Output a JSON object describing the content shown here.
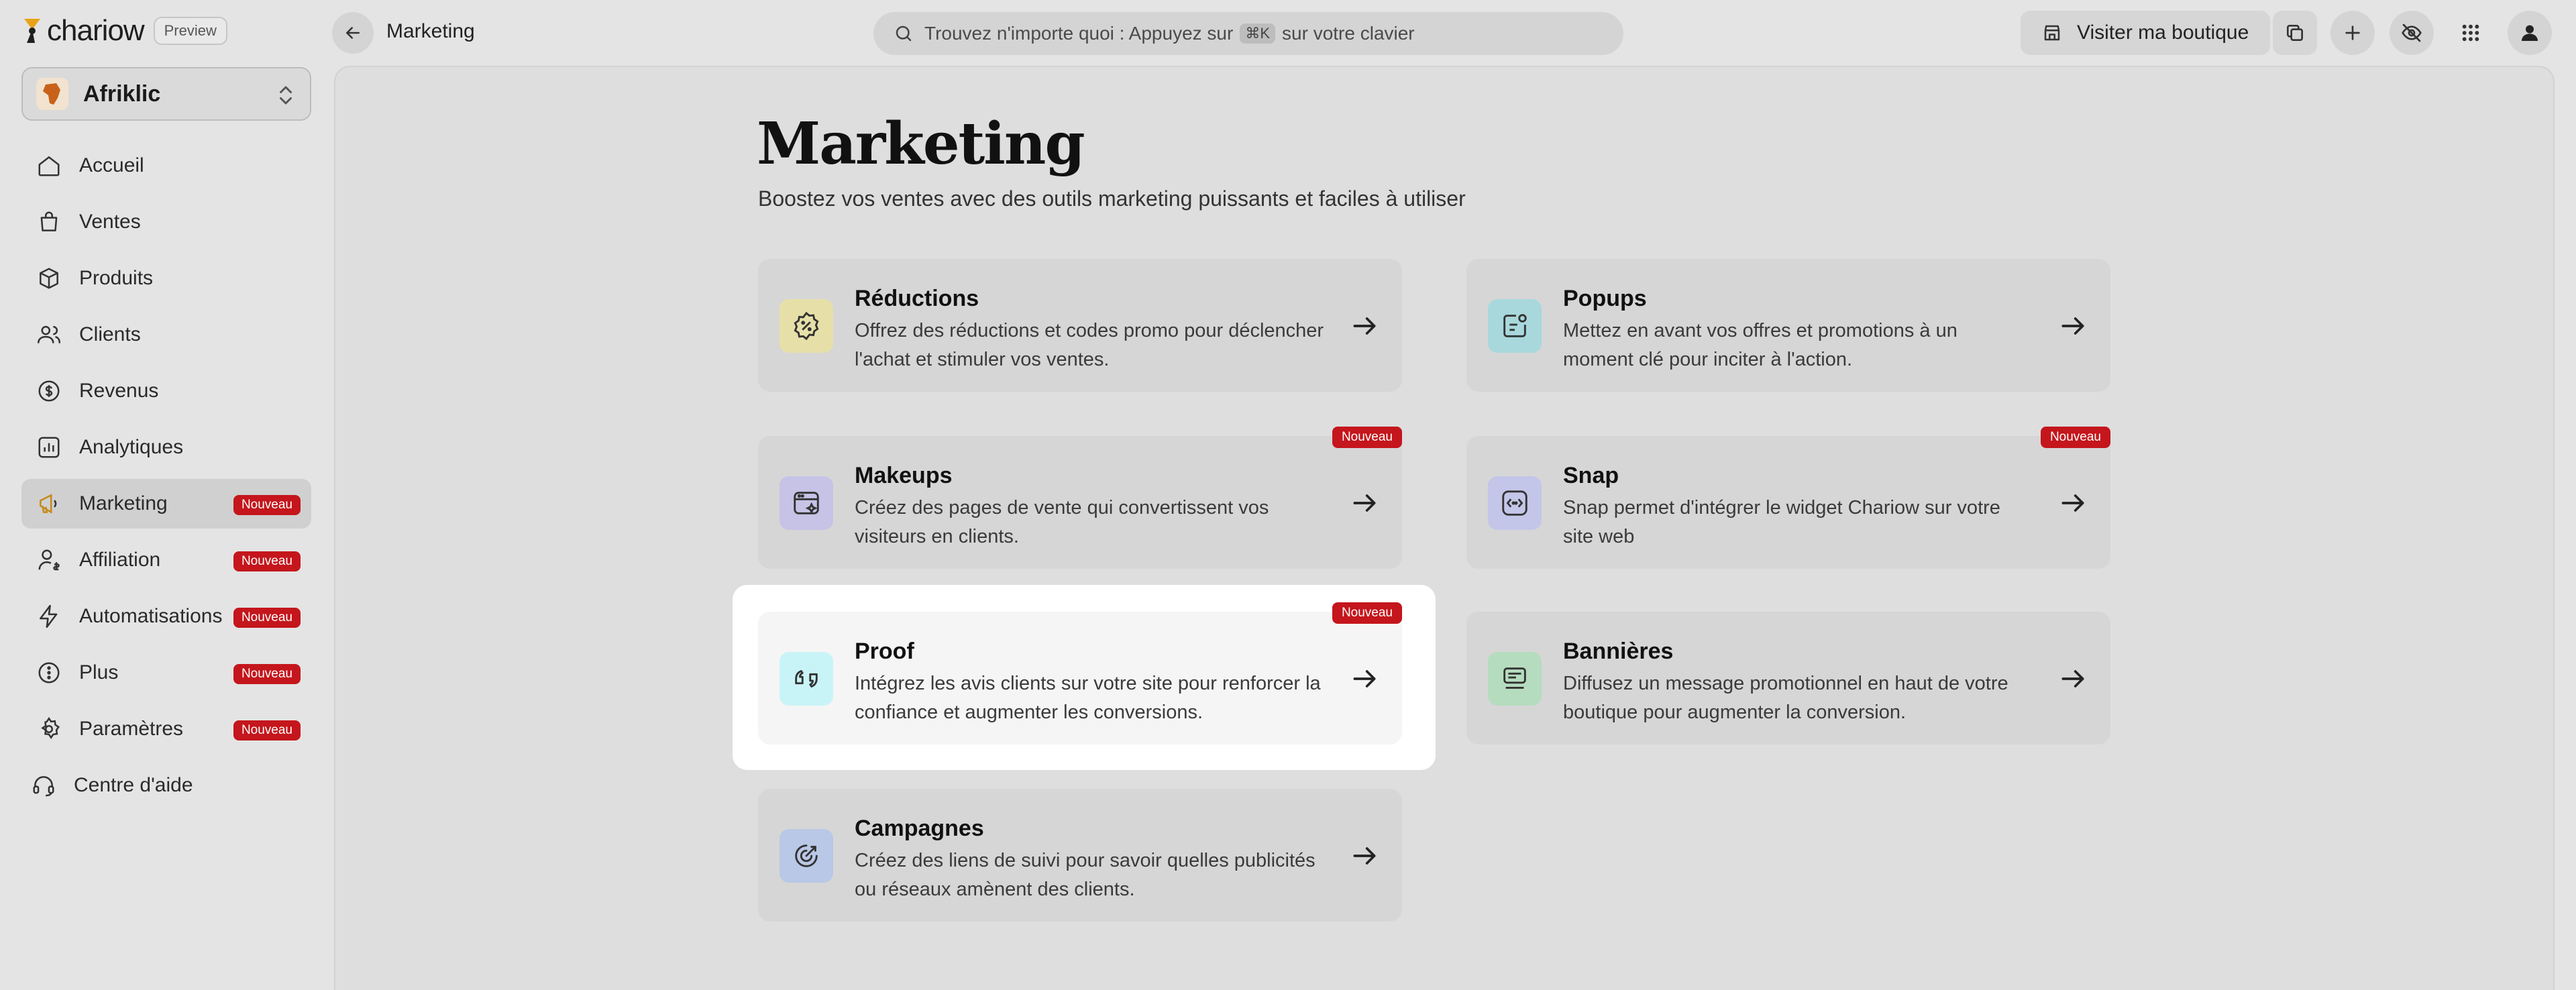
{
  "app": {
    "logo_text": "chariow",
    "preview_label": "Preview"
  },
  "topbar": {
    "title": "Marketing",
    "search_text_before": "Trouvez n'importe quoi : Appuyez sur",
    "search_shortcut": "⌘K",
    "search_text_after": "sur votre clavier",
    "visit_label": "Visiter ma boutique"
  },
  "workspace": {
    "name": "Afriklic"
  },
  "sidebar": {
    "items": [
      {
        "label": "Accueil",
        "icon": "home-icon"
      },
      {
        "label": "Ventes",
        "icon": "shopping-bag-icon"
      },
      {
        "label": "Produits",
        "icon": "box-icon"
      },
      {
        "label": "Clients",
        "icon": "users-icon"
      },
      {
        "label": "Revenus",
        "icon": "dollar-icon"
      },
      {
        "label": "Analytiques",
        "icon": "chart-icon"
      },
      {
        "label": "Marketing",
        "icon": "marketing-icon",
        "badge": "Nouveau",
        "active": true
      },
      {
        "label": "Affiliation",
        "icon": "affiliate-icon",
        "badge": "Nouveau"
      },
      {
        "label": "Automatisations",
        "icon": "bolt-icon",
        "badge": "Nouveau"
      },
      {
        "label": "Plus",
        "icon": "more-icon",
        "badge": "Nouveau"
      },
      {
        "label": "Paramètres",
        "icon": "gear-icon",
        "badge": "Nouveau"
      },
      {
        "label": "Centre d'aide",
        "icon": "headset-icon"
      }
    ]
  },
  "main": {
    "title": "Marketing",
    "subtitle": "Boostez vos ventes avec des outils marketing puissants et faciles à utiliser",
    "cards": [
      {
        "title": "Réductions",
        "desc": "Offrez des réductions et codes promo pour déclencher l'achat et stimuler vos ventes.",
        "icon": "discount-badge-icon",
        "icon_bg": "#e6e0a8"
      },
      {
        "title": "Popups",
        "desc": "Mettez en avant vos offres et promotions à un moment clé pour inciter à l'action.",
        "icon": "popup-icon",
        "icon_bg": "#a8d8dc"
      },
      {
        "title": "Makeups",
        "desc": "Créez des pages de vente qui convertissent vos visiteurs en clients.",
        "icon": "page-builder-icon",
        "icon_bg": "#c6c3e6",
        "badge": "Nouveau"
      },
      {
        "title": "Snap",
        "desc": "Snap permet d'intégrer le widget Chariow sur votre site web",
        "icon": "widget-icon",
        "icon_bg": "#c3c6e8",
        "badge": "Nouveau"
      },
      {
        "title": "Proof",
        "desc": "Intégrez les avis clients sur votre site pour renforcer la confiance et augmenter les conversions.",
        "icon": "reviews-icon",
        "icon_bg": "#c9f4f7",
        "badge": "Nouveau"
      },
      {
        "title": "Bannières",
        "desc": "Diffusez un message promotionnel en haut de votre boutique pour augmenter la conversion.",
        "icon": "banner-icon",
        "icon_bg": "#b6dcbf"
      },
      {
        "title": "Campagnes",
        "desc": "Créez des liens de suivi pour savoir quelles publicités ou réseaux amènent des clients.",
        "icon": "target-icon",
        "icon_bg": "#b9c8e6"
      }
    ]
  },
  "colors": {
    "badge_red": "#c4161c",
    "background": "#e4e4e4"
  }
}
